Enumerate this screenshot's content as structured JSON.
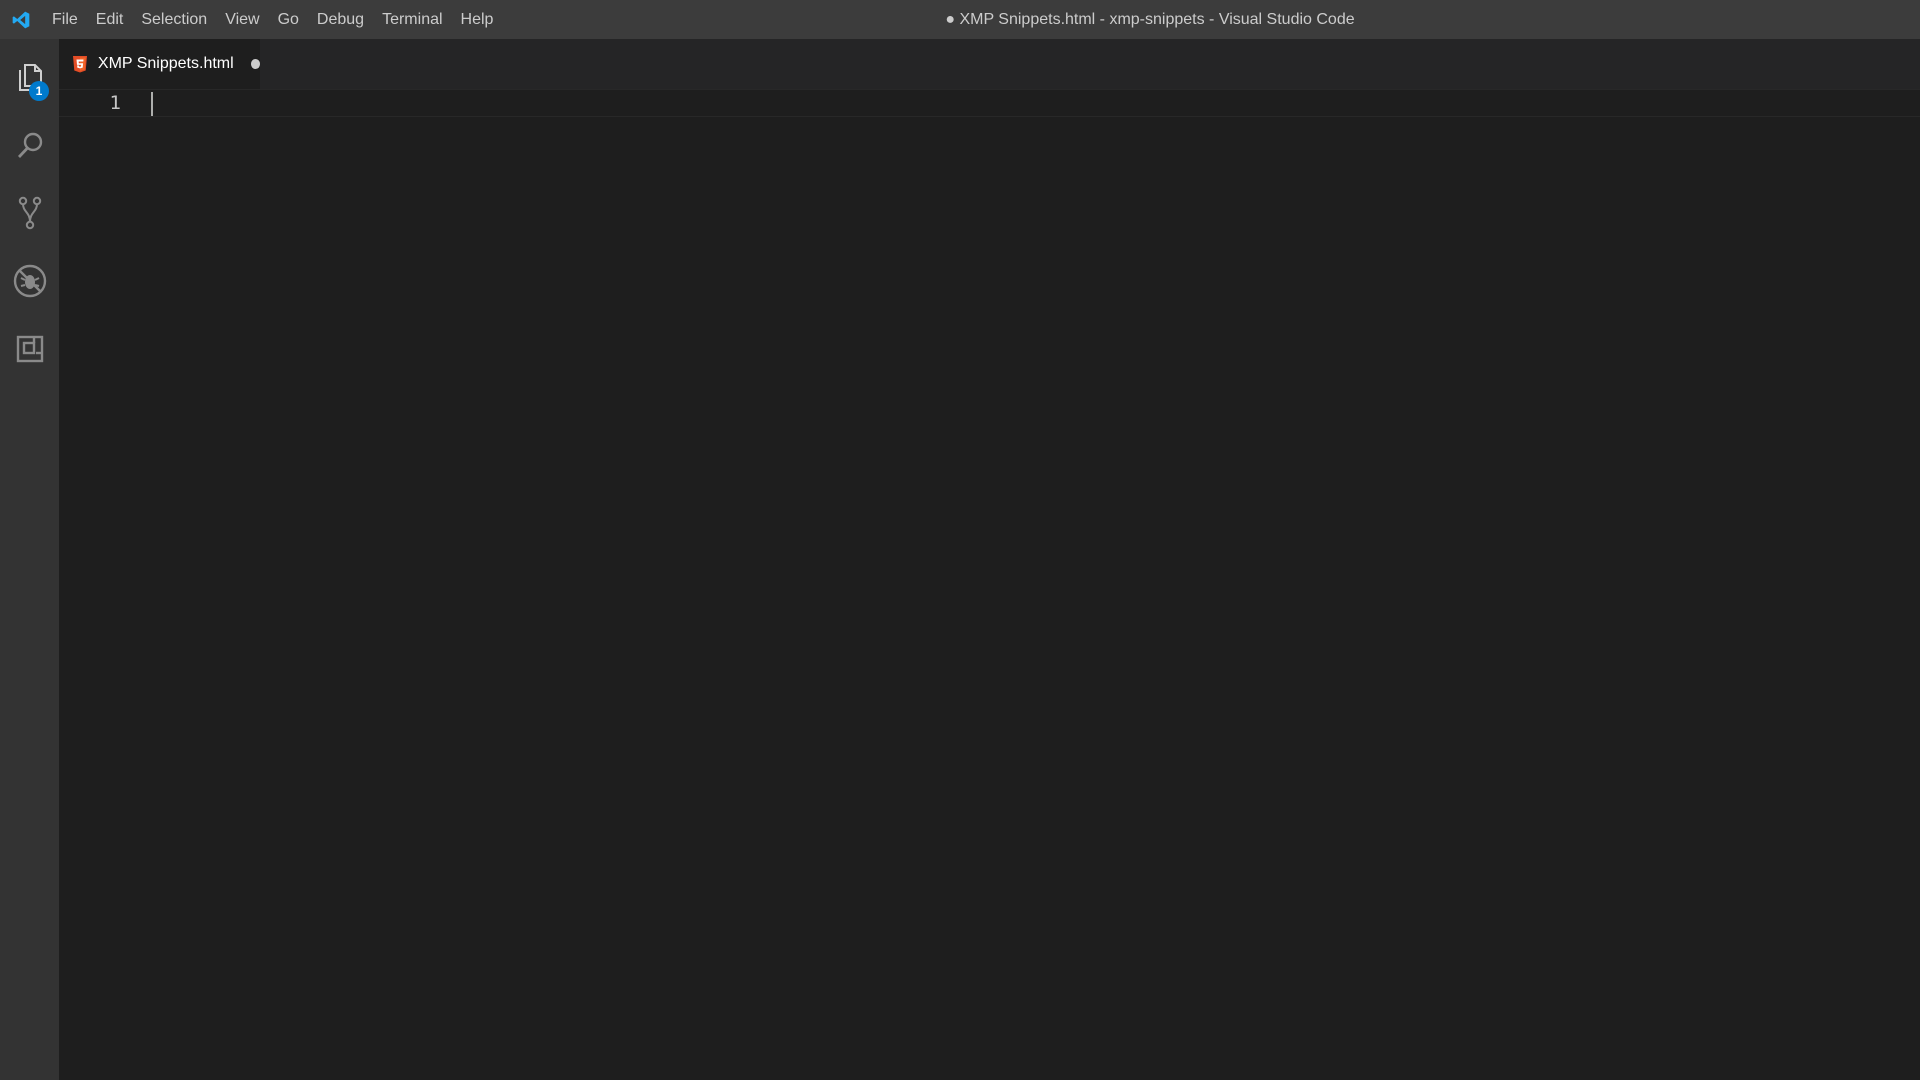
{
  "window": {
    "title": "● XMP Snippets.html - xmp-snippets - Visual Studio Code"
  },
  "menubar": {
    "items": [
      "File",
      "Edit",
      "Selection",
      "View",
      "Go",
      "Debug",
      "Terminal",
      "Help"
    ]
  },
  "activitybar": {
    "items": [
      {
        "name": "explorer",
        "icon": "files-icon",
        "badge": "1"
      },
      {
        "name": "search",
        "icon": "search-icon"
      },
      {
        "name": "source-control",
        "icon": "source-control-icon"
      },
      {
        "name": "debug",
        "icon": "debug-icon"
      },
      {
        "name": "extensions",
        "icon": "extensions-icon"
      }
    ]
  },
  "tabs": [
    {
      "label": "XMP Snippets.html",
      "icon": "html5-icon",
      "dirty": true,
      "active": true
    }
  ],
  "editor": {
    "lines": [
      "1"
    ]
  },
  "colors": {
    "accent": "#007acc",
    "html_icon": "#e44d26",
    "editor_bg": "#1e1e1e",
    "titlebar_bg": "#3c3c3c",
    "activitybar_bg": "#333333"
  }
}
